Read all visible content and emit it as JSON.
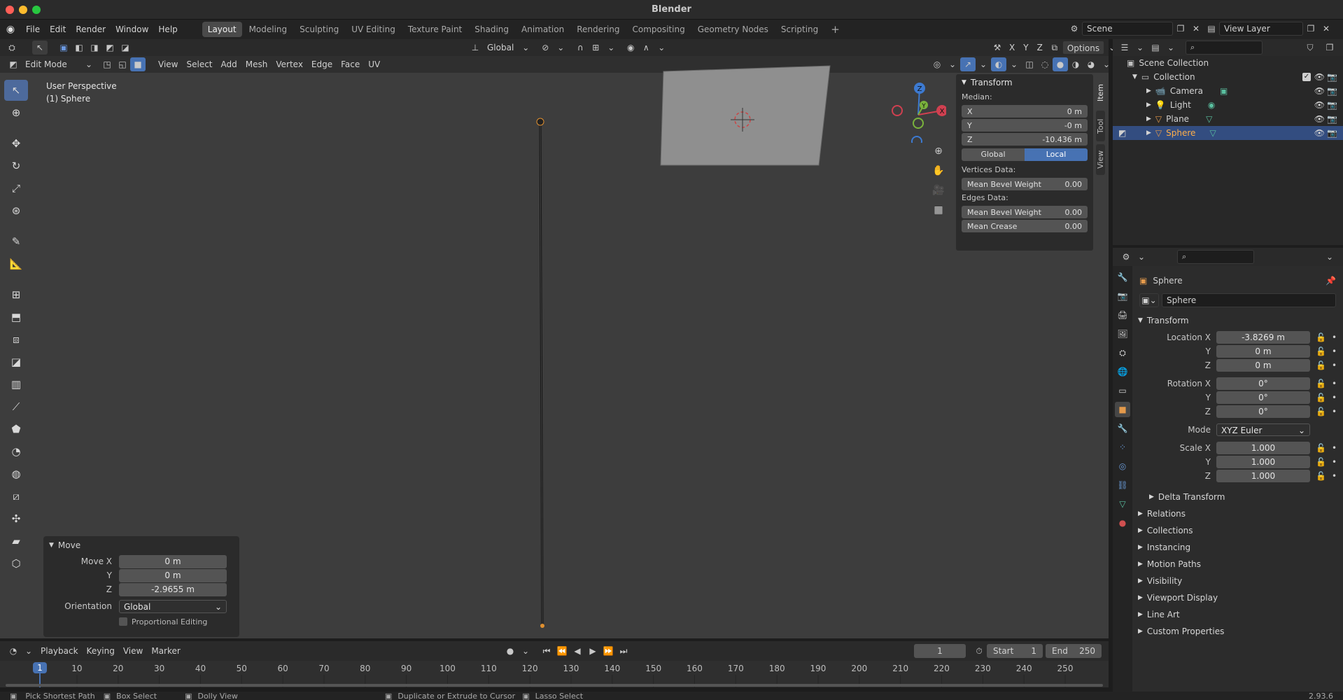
{
  "window": {
    "title": "Blender",
    "traffic_colors": [
      "#ff5f57",
      "#febc2e",
      "#28c840"
    ]
  },
  "menu": [
    "File",
    "Edit",
    "Render",
    "Window",
    "Help"
  ],
  "workspaces": [
    {
      "label": "Layout",
      "active": true
    },
    {
      "label": "Modeling"
    },
    {
      "label": "Sculpting"
    },
    {
      "label": "UV Editing"
    },
    {
      "label": "Texture Paint"
    },
    {
      "label": "Shading"
    },
    {
      "label": "Animation"
    },
    {
      "label": "Rendering"
    },
    {
      "label": "Compositing"
    },
    {
      "label": "Geometry Nodes"
    },
    {
      "label": "Scripting"
    }
  ],
  "add_workspace": "+",
  "scene": {
    "name": "Scene",
    "view_layer": "View Layer"
  },
  "vp_header": {
    "transform_orientation": "Global",
    "options": "Options",
    "axes": [
      "X",
      "Y",
      "Z"
    ]
  },
  "vp_header2": {
    "mode": "Edit Mode",
    "menus": [
      "View",
      "Select",
      "Add",
      "Mesh",
      "Vertex",
      "Edge",
      "Face",
      "UV"
    ]
  },
  "viewport": {
    "perspective": "User Perspective",
    "object": "(1) Sphere",
    "gizmo": {
      "z": "Z",
      "y": "Y",
      "x": "X"
    }
  },
  "npanel": {
    "title": "Transform",
    "median_label": "Median:",
    "median": [
      {
        "axis": "X",
        "value": "0 m"
      },
      {
        "axis": "Y",
        "value": "-0 m"
      },
      {
        "axis": "Z",
        "value": "-10.436 m"
      }
    ],
    "space": {
      "global": "Global",
      "local": "Local",
      "selected": "Local"
    },
    "vertices_label": "Vertices Data:",
    "vertices": [
      {
        "label": "Mean Bevel Weight",
        "value": "0.00"
      }
    ],
    "edges_label": "Edges Data:",
    "edges": [
      {
        "label": "Mean Bevel Weight",
        "value": "0.00"
      },
      {
        "label": "Mean Crease",
        "value": "0.00"
      }
    ],
    "tabs": [
      "Item",
      "Tool",
      "View"
    ]
  },
  "move_panel": {
    "title": "Move",
    "rows": [
      {
        "label": "Move X",
        "value": "0 m"
      },
      {
        "label": "Y",
        "value": "0 m"
      },
      {
        "label": "Z",
        "value": "-2.9655 m"
      }
    ],
    "orientation_label": "Orientation",
    "orientation": "Global",
    "proportional": "Proportional Editing"
  },
  "timeline": {
    "menus": [
      "Playback",
      "Keying",
      "View",
      "Marker"
    ],
    "current_frame": "1",
    "start_label": "Start",
    "start": "1",
    "end_label": "End",
    "end": "250",
    "ticks": [
      "1",
      "10",
      "20",
      "30",
      "40",
      "50",
      "60",
      "70",
      "80",
      "90",
      "100",
      "110",
      "120",
      "130",
      "140",
      "150",
      "160",
      "170",
      "180",
      "190",
      "200",
      "210",
      "220",
      "230",
      "240",
      "250"
    ],
    "playhead": "1"
  },
  "statusbar": {
    "items": [
      "Pick Shortest Path",
      "Box Select",
      "Dolly View",
      "Duplicate or Extrude to Cursor",
      "Lasso Select"
    ],
    "version": "2.93.6"
  },
  "outliner": {
    "root": "Scene Collection",
    "collection": "Collection",
    "items": [
      {
        "label": "Camera",
        "color": "#e49a4b"
      },
      {
        "label": "Light",
        "color": "#e49a4b"
      },
      {
        "label": "Plane",
        "color": "#e49a4b"
      },
      {
        "label": "Sphere",
        "color": "#e49a4b",
        "selected": true
      }
    ]
  },
  "properties": {
    "object_name": "Sphere",
    "datablock": "Sphere",
    "transform_title": "Transform",
    "location": [
      {
        "label": "Location X",
        "value": "-3.8269 m"
      },
      {
        "label": "Y",
        "value": "0 m"
      },
      {
        "label": "Z",
        "value": "0 m"
      }
    ],
    "rotation": [
      {
        "label": "Rotation X",
        "value": "0°"
      },
      {
        "label": "Y",
        "value": "0°"
      },
      {
        "label": "Z",
        "value": "0°"
      }
    ],
    "mode_label": "Mode",
    "mode": "XYZ Euler",
    "scale": [
      {
        "label": "Scale X",
        "value": "1.000"
      },
      {
        "label": "Y",
        "value": "1.000"
      },
      {
        "label": "Z",
        "value": "1.000"
      }
    ],
    "delta": "Delta Transform",
    "sections": [
      "Relations",
      "Collections",
      "Instancing",
      "Motion Paths",
      "Visibility",
      "Viewport Display",
      "Line Art",
      "Custom Properties"
    ]
  },
  "colors": {
    "accent": "#4772b3",
    "selection": "#334d80",
    "viewport": "#3d3d3d",
    "panel": "#2b2b2b"
  }
}
